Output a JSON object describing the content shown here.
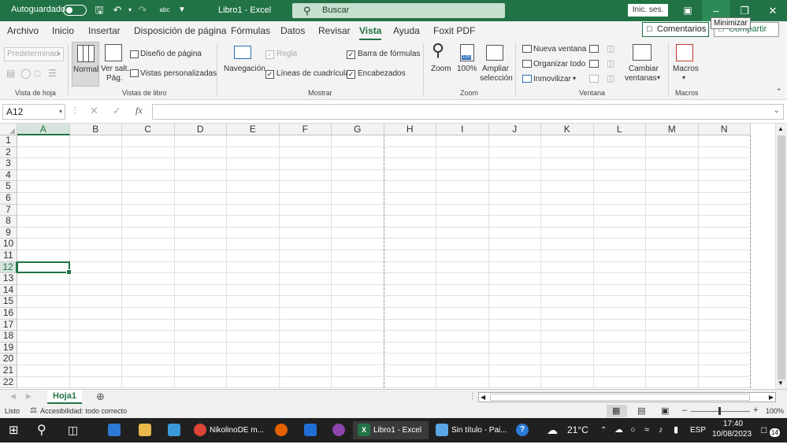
{
  "window": {
    "autosave_label": "Autoguardado",
    "title": "Libro1  -  Excel",
    "search_placeholder": "Buscar",
    "signin_label": "Inic. ses.",
    "tooltip": "Minimizar",
    "accent": "#217346"
  },
  "menu": {
    "tabs": [
      "Archivo",
      "Inicio",
      "Insertar",
      "Disposición de página",
      "Fórmulas",
      "Datos",
      "Revisar",
      "Vista",
      "Ayuda",
      "Foxit PDF"
    ],
    "active_tab": "Vista",
    "comments_label": "Comentarios",
    "share_label": "Compartir"
  },
  "ribbon": {
    "vista_hoja": {
      "label": "Vista de hoja",
      "combo_value": "Predeterminad"
    },
    "vistas_libro": {
      "label": "Vistas de libro",
      "normal": "Normal",
      "saltos_1": "Ver salt.",
      "saltos_2": "Pág.",
      "diseno": "Diseño de página",
      "personalizadas": "Vistas personalizadas"
    },
    "mostrar": {
      "label": "Mostrar",
      "navegacion": "Navegación",
      "regla": "Regla",
      "lineas": "Líneas de cuadrícula",
      "barra": "Barra de fórmulas",
      "encabezados": "Encabezados"
    },
    "zoom": {
      "label": "Zoom",
      "zoom": "Zoom",
      "pct": "100%",
      "ampliar_1": "Ampliar",
      "ampliar_2": "selección"
    },
    "ventana": {
      "label": "Ventana",
      "nueva": "Nueva ventana",
      "organizar": "Organizar todo",
      "inmovilizar": "Inmovilizar",
      "cambiar_1": "Cambiar",
      "cambiar_2": "ventanas"
    },
    "macros": {
      "label": "Macros",
      "macros": "Macros"
    }
  },
  "formula_bar": {
    "name_box": "A12",
    "fx": "fx",
    "value": ""
  },
  "sheet": {
    "columns": [
      "A",
      "B",
      "C",
      "D",
      "E",
      "F",
      "G",
      "H",
      "I",
      "J",
      "K",
      "L",
      "M",
      "N"
    ],
    "rows": [
      "1",
      "2",
      "3",
      "4",
      "5",
      "6",
      "7",
      "8",
      "9",
      "10",
      "11",
      "12",
      "13",
      "14",
      "15",
      "16",
      "17",
      "18",
      "19",
      "20",
      "21",
      "22"
    ],
    "selected_cell": "A12",
    "selected_col": "A",
    "selected_row": "12",
    "tab_name": "Hoja1"
  },
  "status": {
    "ready": "Listo",
    "accessibility": "Accesibilidad: todo correcto",
    "zoom": "100%"
  },
  "taskbar": {
    "chrome_label": "NikolinoDE m...",
    "excel_label": "Libro1 - Excel",
    "paint_label": "Sin título - Pai...",
    "temperature": "21°C",
    "language": "ESP",
    "time": "17:40",
    "date": "10/08/2023",
    "notifications": "14"
  }
}
